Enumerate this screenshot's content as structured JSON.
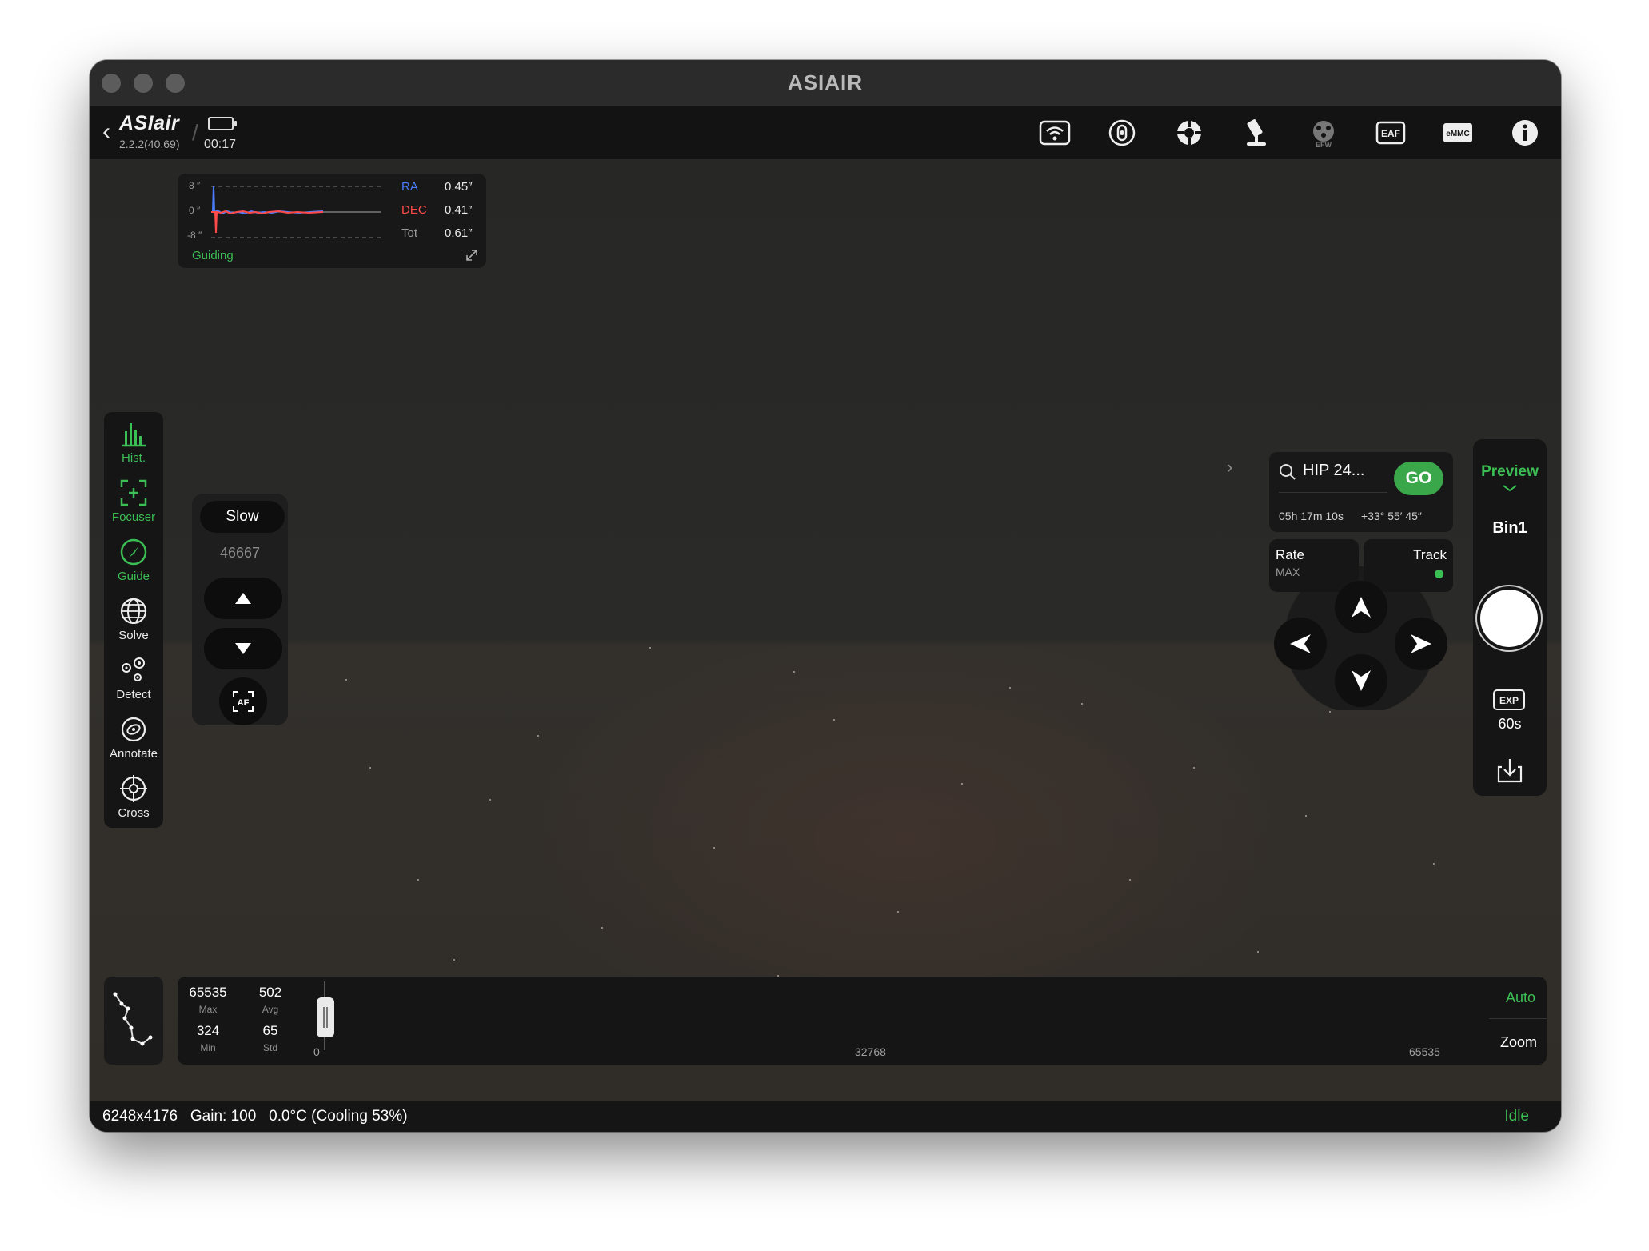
{
  "window": {
    "title": "ASIAIR"
  },
  "appbar": {
    "logo": "ASIair",
    "version": "2.2.2(40.69)",
    "timer": "00:17",
    "icons": [
      "wifi-icon",
      "cooler-icon",
      "guide-cam-icon",
      "mount-icon",
      "efw-icon",
      "eaf-icon",
      "emmc-icon",
      "info-icon"
    ]
  },
  "guide_panel": {
    "scale": [
      "8 ″",
      "0 ″",
      "-8 ″"
    ],
    "ra": {
      "label": "RA",
      "value": "0.45″",
      "color": "#4a7dff"
    },
    "dec": {
      "label": "DEC",
      "value": "0.41″",
      "color": "#ff4a4a"
    },
    "tot": {
      "label": "Tot",
      "value": "0.61″"
    },
    "status": "Guiding"
  },
  "left_toolbar": [
    {
      "name": "hist",
      "label": "Hist.",
      "active": true
    },
    {
      "name": "focuser",
      "label": "Focuser",
      "active": true
    },
    {
      "name": "guide",
      "label": "Guide",
      "active": true
    },
    {
      "name": "solve",
      "label": "Solve",
      "active": false
    },
    {
      "name": "detect",
      "label": "Detect",
      "active": false
    },
    {
      "name": "annotate",
      "label": "Annotate",
      "active": false
    },
    {
      "name": "cross",
      "label": "Cross",
      "active": false
    }
  ],
  "focuser": {
    "speed": "Slow",
    "position": "46667"
  },
  "target": {
    "name": "HIP 24...",
    "go_label": "GO",
    "ra": "05h 17m 10s",
    "dec": "+33° 55′ 45″"
  },
  "mount": {
    "rate_label": "Rate",
    "rate_value": "MAX",
    "track_label": "Track",
    "tracking": true
  },
  "capture": {
    "mode": "Preview",
    "bin": "Bin1",
    "exp_label": "EXP",
    "exposure": "60s"
  },
  "stats": {
    "max": {
      "value": "65535",
      "label": "Max"
    },
    "avg": {
      "value": "502",
      "label": "Avg"
    },
    "min": {
      "value": "324",
      "label": "Min"
    },
    "std": {
      "value": "65",
      "label": "Std"
    },
    "ticks": [
      "0",
      "32768",
      "65535"
    ],
    "auto": "Auto",
    "zoom": "Zoom"
  },
  "status": {
    "resolution": "6248x4176",
    "gain": "Gain: 100",
    "temperature": "0.0°C (Cooling 53%)",
    "state": "Idle"
  },
  "colors": {
    "accent": "#3bbf55",
    "go": "#3aa74a"
  }
}
